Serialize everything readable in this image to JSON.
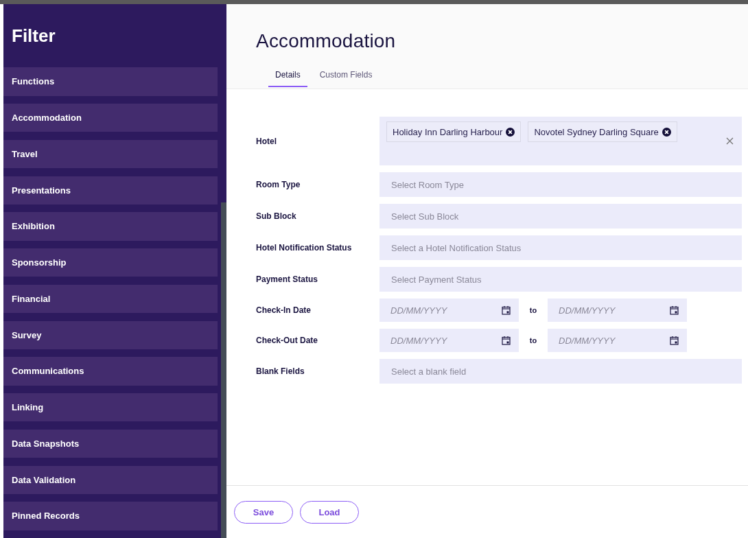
{
  "sidebar": {
    "title": "Filter",
    "items": [
      {
        "label": "Functions"
      },
      {
        "label": "Accommodation"
      },
      {
        "label": "Travel"
      },
      {
        "label": "Presentations"
      },
      {
        "label": "Exhibition"
      },
      {
        "label": "Sponsorship"
      },
      {
        "label": "Financial"
      },
      {
        "label": "Survey"
      },
      {
        "label": "Communications"
      },
      {
        "label": "Linking"
      },
      {
        "label": "Data Snapshots"
      },
      {
        "label": "Data Validation"
      },
      {
        "label": "Pinned Records"
      }
    ]
  },
  "main": {
    "title": "Accommodation",
    "tabs": [
      {
        "label": "Details",
        "selected": true
      },
      {
        "label": "Custom Fields",
        "selected": false
      }
    ],
    "fields": [
      {
        "kind": "multiselect",
        "label": "Hotel",
        "tags": [
          "Holiday Inn Darling Harbour",
          "Novotel Sydney Darling Square"
        ]
      },
      {
        "kind": "select",
        "label": "Room Type",
        "placeholder": "Select Room Type"
      },
      {
        "kind": "select",
        "label": "Sub Block",
        "placeholder": "Select Sub Block"
      },
      {
        "kind": "select",
        "label": "Hotel Notification Status",
        "placeholder": "Select a Hotel Notification Status"
      },
      {
        "kind": "select",
        "label": "Payment Status",
        "placeholder": "Select Payment Status"
      },
      {
        "kind": "daterange",
        "label": "Check-In Date",
        "from_placeholder": "DD/MM/YYYY",
        "separator": "to",
        "to_placeholder": "DD/MM/YYYY"
      },
      {
        "kind": "daterange",
        "label": "Check-Out Date",
        "from_placeholder": "DD/MM/YYYY",
        "separator": "to",
        "to_placeholder": "DD/MM/YYYY"
      },
      {
        "kind": "select",
        "label": "Blank Fields",
        "placeholder": "Select a blank field"
      }
    ],
    "buttons": [
      "Save",
      "Load"
    ]
  }
}
